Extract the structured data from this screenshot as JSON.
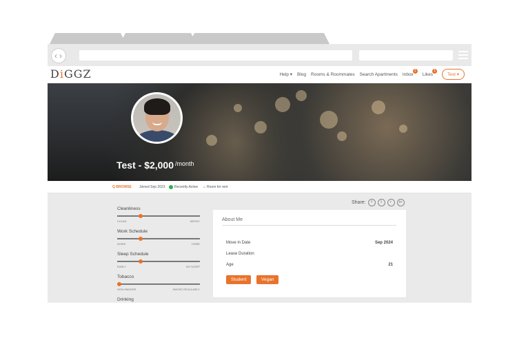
{
  "header": {
    "logo_prefix": "D",
    "logo_i": "i",
    "logo_suffix": "GGZ",
    "nav": {
      "help": "Help ▾",
      "blog": "Blog",
      "rooms": "Rooms & Roommates",
      "search": "Search Apartments",
      "inbox": "Inbox",
      "inbox_count": "1",
      "likes": "Likes",
      "likes_count": "1",
      "user": "Test ▾"
    }
  },
  "hero": {
    "title": "Test - $2,000",
    "per": "/month"
  },
  "strip": {
    "browse": "Q BROWSE",
    "joined": "Joined Sep 2023",
    "active": "Recently Active",
    "room": "Room for rent"
  },
  "preferences": [
    {
      "label": "Cleanliness",
      "left": "CLEAN",
      "right": "MESSY",
      "level": 0.27
    },
    {
      "label": "Work Schedule",
      "left": "WORK",
      "right": "HOME",
      "level": 0.27
    },
    {
      "label": "Sleep Schedule",
      "left": "EARLY",
      "right": "NO SLEEP",
      "level": 0.27
    },
    {
      "label": "Tobacco",
      "left": "NON-SMOKER",
      "right": "SMOKE REGULARLY",
      "level": 0.0
    },
    {
      "label": "Drinking",
      "left": "",
      "right": "",
      "level": 0.0
    }
  ],
  "share": {
    "label": "Share:",
    "icons": [
      "f",
      "t",
      "r",
      "in"
    ]
  },
  "about": {
    "heading": "About Me",
    "rows": [
      {
        "label": "Move in Date",
        "value": "Sep 2024"
      },
      {
        "label": "Lease Duration",
        "value": ""
      },
      {
        "label": "Age",
        "value": "21"
      }
    ],
    "tags": [
      "Student",
      "Vegan"
    ]
  },
  "colors": {
    "accent": "#e8732c",
    "active_green": "#2eae4c"
  }
}
